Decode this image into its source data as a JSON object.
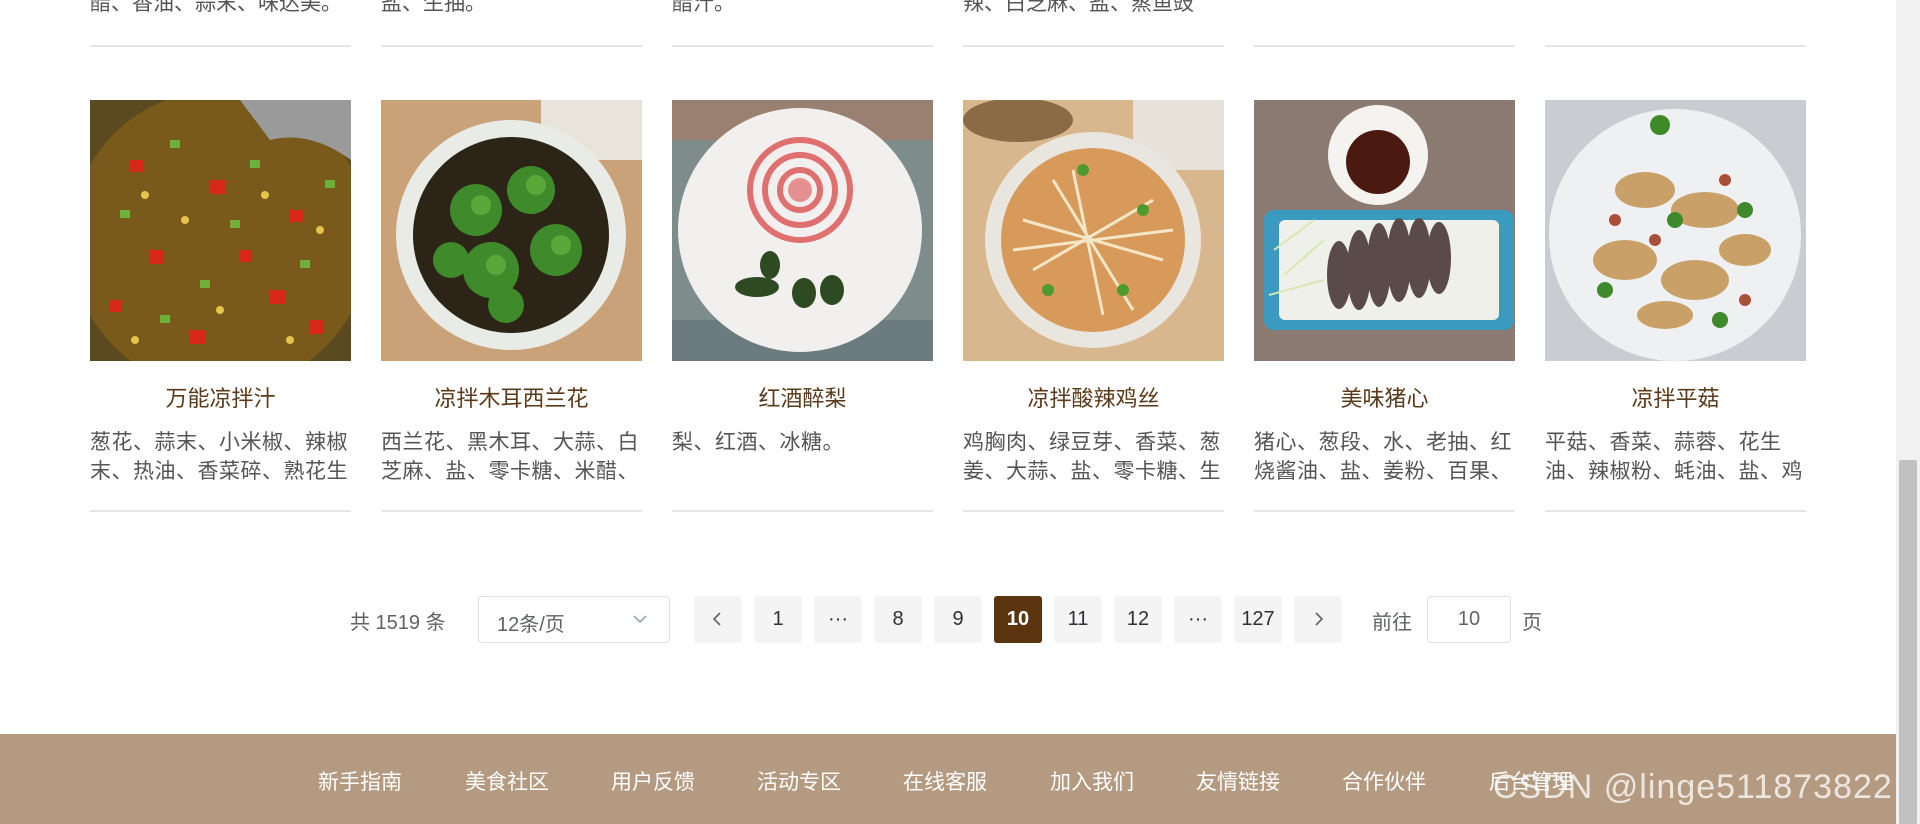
{
  "top_row": [
    "醋、香油、蒜末、味达美。",
    "盐、生抽。",
    "醋汁。",
    "辣、白芝麻、盐、蒸鱼豉",
    "",
    ""
  ],
  "recipes": [
    {
      "name": "万能凉拌汁",
      "desc": "葱花、蒜末、小米椒、辣椒末、热油、香菜碎、熟花生",
      "icon": "sauce-bowl-photo"
    },
    {
      "name": "凉拌木耳西兰花",
      "desc": "西兰花、黑木耳、大蒜、白芝麻、盐、零卡糖、米醋、",
      "icon": "broccoli-fungus-photo"
    },
    {
      "name": "红酒醉梨",
      "desc": "梨、红酒、冰糖。",
      "icon": "wine-pear-photo"
    },
    {
      "name": "凉拌酸辣鸡丝",
      "desc": "鸡胸肉、绿豆芽、香菜、葱姜、大蒜、盐、零卡糖、生",
      "icon": "shredded-chicken-photo"
    },
    {
      "name": "美味猪心",
      "desc": "猪心、葱段、水、老抽、红烧酱油、盐、姜粉、百果、",
      "icon": "pork-heart-photo"
    },
    {
      "name": "凉拌平菇",
      "desc": "平菇、香菜、蒜蓉、花生油、辣椒粉、蚝油、盐、鸡",
      "icon": "oyster-mushroom-photo"
    }
  ],
  "pagination": {
    "total": "共 1519 条",
    "page_size": "12条/页",
    "prev_icon": "chevron-left-icon",
    "next_icon": "chevron-right-icon",
    "pages": [
      "1",
      "···",
      "8",
      "9",
      "10",
      "11",
      "12",
      "···",
      "127"
    ],
    "current": "10",
    "goto_label": "前往",
    "goto_value": "10",
    "goto_unit": "页"
  },
  "footer": {
    "links": [
      "新手指南",
      "美食社区",
      "用户反馈",
      "活动专区",
      "在线客服",
      "加入我们",
      "友情链接",
      "合作伙伴",
      "后台管理"
    ],
    "watermark": "CSDN @linge511873822"
  },
  "colors": {
    "active_page": "#5b3510",
    "footer_bg": "#b39a80",
    "recipe_title": "#5a3a1a"
  }
}
